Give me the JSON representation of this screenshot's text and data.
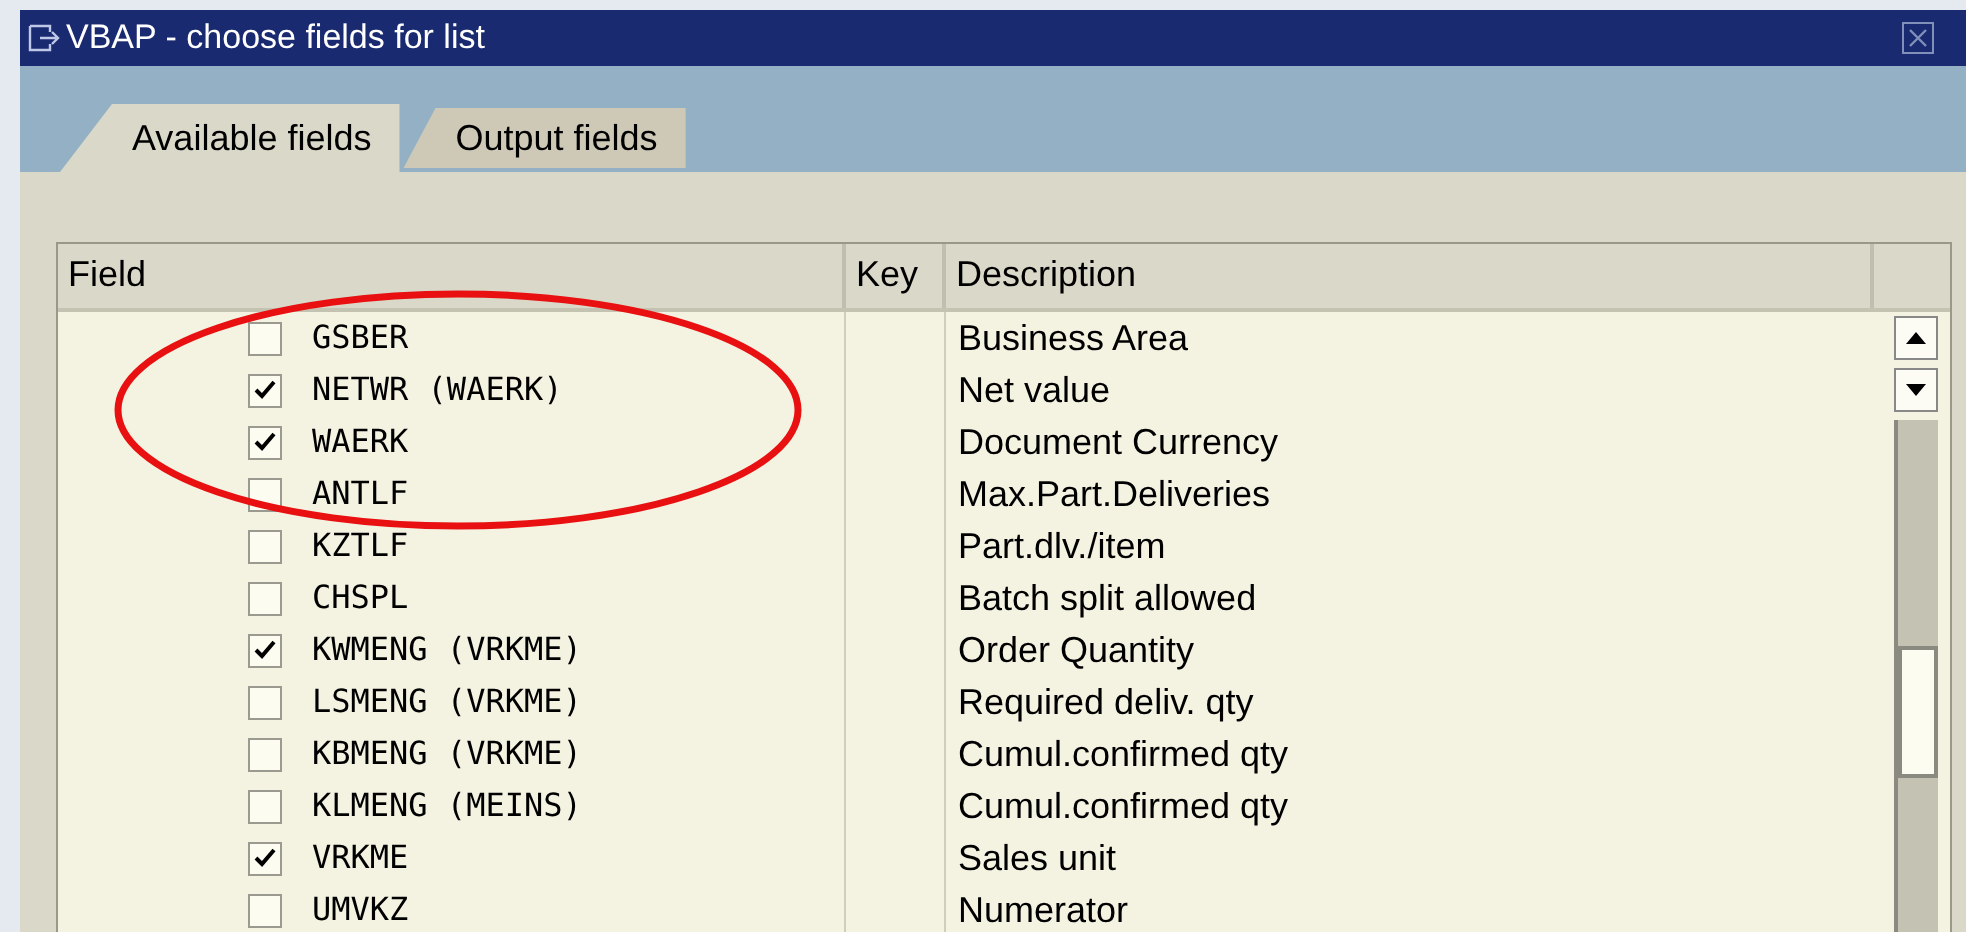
{
  "window": {
    "title": "VBAP - choose fields for list"
  },
  "tabs": [
    {
      "label": "Available fields",
      "selected": true
    },
    {
      "label": "Output fields",
      "selected": false
    }
  ],
  "table": {
    "columns": [
      "Field",
      "Key",
      "Description"
    ],
    "rows": [
      {
        "field": "GSBER",
        "checked": false,
        "description": "Business Area"
      },
      {
        "field": "NETWR (WAERK)",
        "checked": true,
        "description": "Net value"
      },
      {
        "field": "WAERK",
        "checked": true,
        "description": "Document Currency"
      },
      {
        "field": "ANTLF",
        "checked": false,
        "description": "Max.Part.Deliveries"
      },
      {
        "field": "KZTLF",
        "checked": false,
        "description": "Part.dlv./item"
      },
      {
        "field": "CHSPL",
        "checked": false,
        "description": "Batch split allowed"
      },
      {
        "field": "KWMENG (VRKME)",
        "checked": true,
        "description": "Order Quantity"
      },
      {
        "field": "LSMENG (VRKME)",
        "checked": false,
        "description": "Required deliv. qty"
      },
      {
        "field": "KBMENG (VRKME)",
        "checked": false,
        "description": "Cumul.confirmed qty"
      },
      {
        "field": "KLMENG (MEINS)",
        "checked": false,
        "description": "Cumul.confirmed qty"
      },
      {
        "field": "VRKME",
        "checked": true,
        "description": "Sales unit"
      },
      {
        "field": "UMVKZ",
        "checked": false,
        "description": "Numerator"
      }
    ]
  },
  "annotations": [
    {
      "kind": "ellipse"
    }
  ]
}
